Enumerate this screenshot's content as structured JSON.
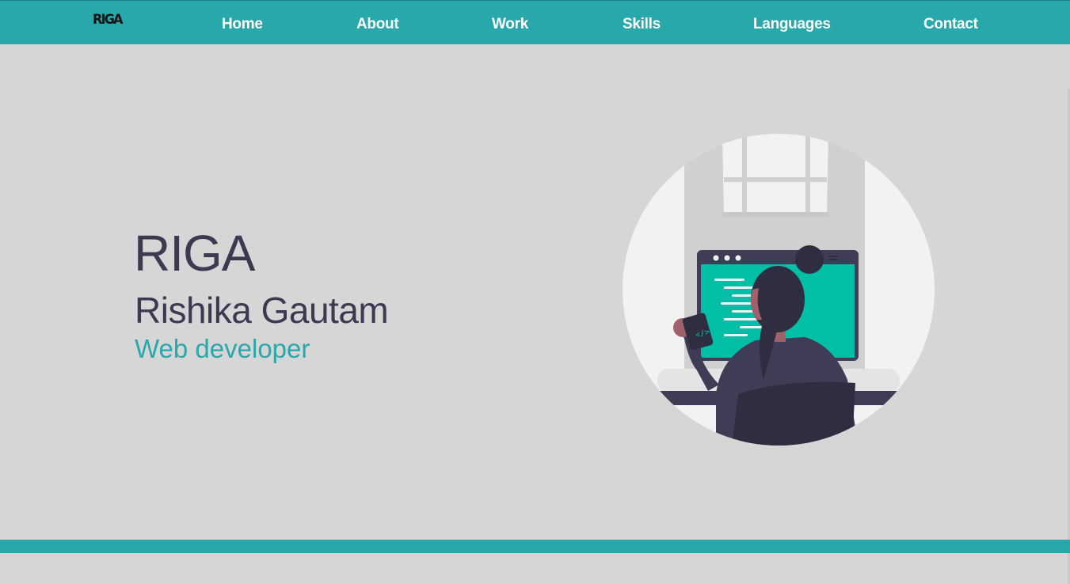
{
  "nav": {
    "logo": "RIGA",
    "links": [
      "Home",
      "About",
      "Work",
      "Skills",
      "Languages",
      "Contact"
    ]
  },
  "hero": {
    "brand": "RIGA",
    "name": "Rishika Gautam",
    "role": "Web developer"
  },
  "colors": {
    "accent": "#29a8ab",
    "text_dark": "#3b3a51",
    "background": "#d6d6d6",
    "screen_green": "#00bfa6"
  },
  "illustration": {
    "icon": "woman-coding-illustration"
  }
}
